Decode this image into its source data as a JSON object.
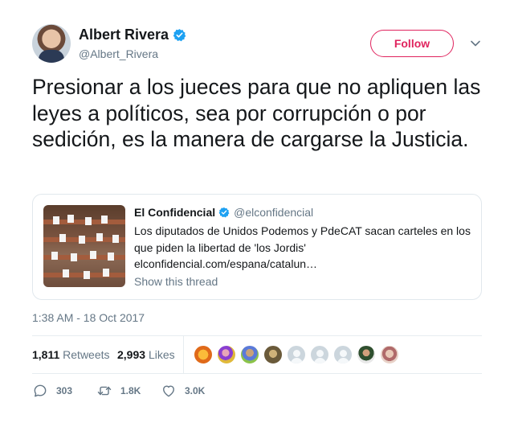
{
  "author": {
    "display_name": "Albert Rivera",
    "handle": "@Albert_Rivera",
    "verified_icon": "verified-badge-icon"
  },
  "follow_label": "Follow",
  "tweet_text": "Presionar a los jueces para que no apliquen las leyes a políticos, sea por corrupción o por sedición, es la manera de cargarse la Justicia.",
  "quoted_tweet": {
    "display_name": "El Confidencial",
    "handle": "@elconfidencial",
    "body": "Los diputados de Unidos Podemos y PdeCAT sacan carteles en los que piden la libertad de 'los Jordis' elconfidencial.com/espana/catalun…",
    "show_thread": "Show this thread"
  },
  "timestamp": "1:38 AM - 18 Oct 2017",
  "stats": {
    "retweets_count": "1,811",
    "retweets_label": "Retweets",
    "likes_count": "2,993",
    "likes_label": "Likes"
  },
  "actions": {
    "replies": "303",
    "retweets": "1.8K",
    "likes": "3.0K"
  },
  "colors": {
    "accent": "#e0245e",
    "verified": "#1da1f2",
    "muted": "#657786"
  }
}
